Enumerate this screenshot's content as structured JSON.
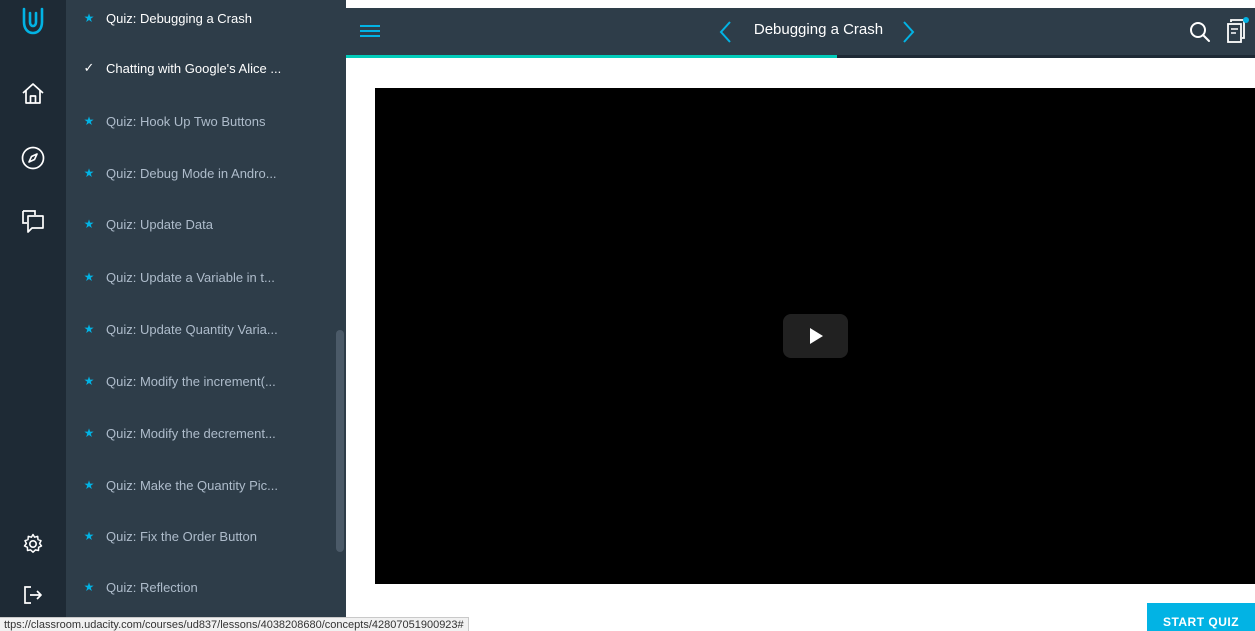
{
  "colors": {
    "rail_bg": "#1e2a35",
    "panel_bg": "#2e3d49",
    "accent_blue": "#02b3e4",
    "progress_teal": "#02ccba",
    "video_bg": "#000000"
  },
  "rail": {
    "icons": [
      "udacity-logo-icon",
      "home-icon",
      "compass-icon",
      "chat-icon",
      "gear-icon",
      "logout-icon"
    ]
  },
  "lessons": {
    "items": [
      {
        "label": "Quiz: Debugging a Crash",
        "status": "star",
        "current": true
      },
      {
        "label": "Chatting with Google's Alice ...",
        "status": "check",
        "current": false
      },
      {
        "label": "Quiz: Hook Up Two Buttons",
        "status": "star",
        "current": false
      },
      {
        "label": "Quiz: Debug Mode in Andro...",
        "status": "star",
        "current": false
      },
      {
        "label": "Quiz: Update Data",
        "status": "star",
        "current": false
      },
      {
        "label": "Quiz: Update a Variable in t...",
        "status": "star",
        "current": false
      },
      {
        "label": "Quiz: Update Quantity Varia...",
        "status": "star",
        "current": false
      },
      {
        "label": "Quiz: Modify the increment(...",
        "status": "star",
        "current": false
      },
      {
        "label": "Quiz: Modify the decrement...",
        "status": "star",
        "current": false
      },
      {
        "label": "Quiz: Make the Quantity Pic...",
        "status": "star",
        "current": false
      },
      {
        "label": "Quiz: Fix the Order Button",
        "status": "star",
        "current": false
      },
      {
        "label": "Quiz: Reflection",
        "status": "star",
        "current": false
      }
    ]
  },
  "header": {
    "title": "Debugging a Crash",
    "progress": 0.54,
    "icons": [
      "menu-icon",
      "chevron-left-icon",
      "chevron-right-icon",
      "search-icon",
      "resources-icon"
    ]
  },
  "video": {
    "play_icon": "play-icon"
  },
  "footer": {
    "start_quiz_label": "START QUIZ",
    "status_url": "ttps://classroom.udacity.com/courses/ud837/lessons/4038208680/concepts/42807051900923#"
  }
}
